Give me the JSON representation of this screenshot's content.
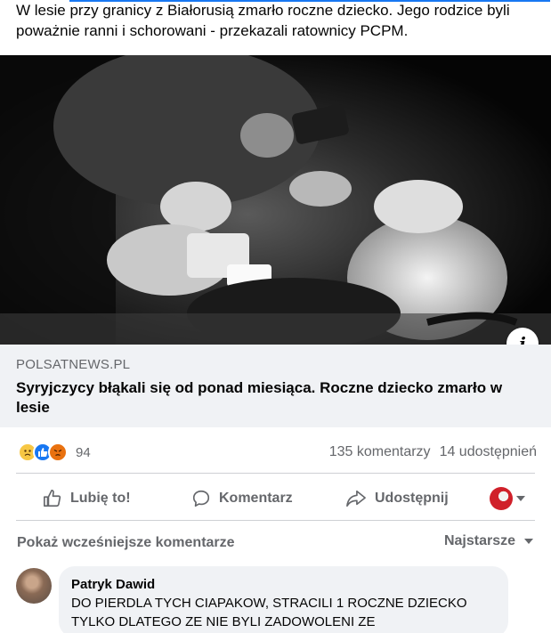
{
  "post": {
    "text": "W lesie przy granicy z Białorusią zmarło roczne dziecko. Jego rodzice byli poważnie ranni i schorowani - przekazali ratownicy PCPM."
  },
  "link_preview": {
    "domain": "POLSATNEWS.PL",
    "title": "Syryjczycy błąkali się od ponad miesiąca. Roczne dziecko zmarło w lesie",
    "info_icon": "info-icon"
  },
  "stats": {
    "reaction_icons": [
      "sad-reaction-icon",
      "like-reaction-icon",
      "angry-reaction-icon"
    ],
    "reaction_count": "94",
    "comments": "135 komentarzy",
    "shares": "14 udostępnień"
  },
  "actions": {
    "like": "Lubię to!",
    "comment": "Komentarz",
    "share": "Udostępnij"
  },
  "comments_section": {
    "more_comments": "Pokaż wcześniejsze komentarze",
    "sort": "Najstarsze"
  },
  "comment": {
    "author": "Patryk Dawid",
    "text": "DO PIERDLA TYCH CIAPAKOW, STRACILI 1 ROCZNE DZIECKO TYLKO DLATEGO ZE NIE BYLI ZADOWOLENI ZE"
  },
  "colors": {
    "accent": "#1877f2",
    "muted_text": "#65676b",
    "card_bg": "#f0f2f5"
  }
}
